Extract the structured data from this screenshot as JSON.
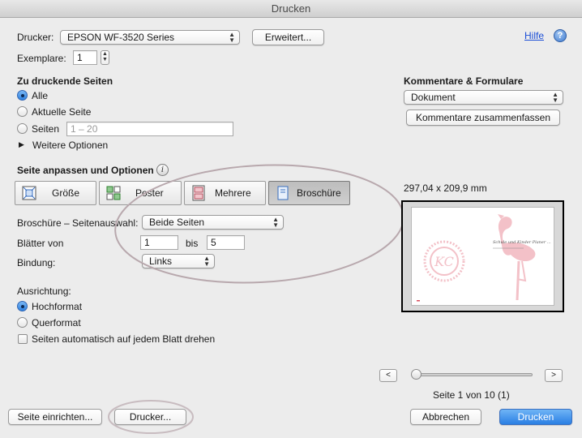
{
  "window": {
    "title": "Drucken"
  },
  "printer": {
    "label": "Drucker:",
    "selected": "EPSON WF-3520 Series",
    "advanced_button": "Erweitert..."
  },
  "help": {
    "label": "Hilfe",
    "icon": "?"
  },
  "copies": {
    "label": "Exemplare:",
    "value": "1"
  },
  "pages": {
    "heading": "Zu druckende Seiten",
    "options": [
      {
        "label": "Alle",
        "selected": true
      },
      {
        "label": "Aktuelle Seite",
        "selected": false
      },
      {
        "label": "Seiten",
        "selected": false
      }
    ],
    "range_placeholder": "1 – 20",
    "more_options": "Weitere Optionen"
  },
  "comments": {
    "heading": "Kommentare & Formulare",
    "selected": "Dokument",
    "summarize_button": "Kommentare zusammenfassen"
  },
  "fit": {
    "heading": "Seite anpassen und Optionen",
    "tiles": [
      {
        "label": "Größe",
        "icon": "size-icon"
      },
      {
        "label": "Poster",
        "icon": "poster-icon"
      },
      {
        "label": "Mehrere",
        "icon": "multiple-icon"
      },
      {
        "label": "Broschüre",
        "icon": "booklet-icon",
        "selected": true
      }
    ]
  },
  "booklet": {
    "subset_label": "Broschüre – Seitenauswahl:",
    "subset_value": "Beide Seiten",
    "sheets_label": "Blätter von",
    "sheets_from": "1",
    "sheets_to_label": "bis",
    "sheets_to": "5",
    "binding_label": "Bindung:",
    "binding_value": "Links"
  },
  "orientation": {
    "heading": "Ausrichtung:",
    "options": [
      {
        "label": "Hochformat",
        "selected": true
      },
      {
        "label": "Querformat",
        "selected": false
      }
    ],
    "auto_rotate": "Seiten automatisch auf jedem Blatt drehen"
  },
  "preview": {
    "size": "297,04 x 209,9 mm",
    "page_info": "Seite 1 von 10 (1)",
    "prev": "<",
    "next": ">",
    "logo_text": "KC",
    "script_text": "Schule und Kinder Planer ..."
  },
  "footer": {
    "page_setup": "Seite einrichten...",
    "printer": "Drucker...",
    "cancel": "Abbrechen",
    "print": "Drucken"
  },
  "colors": {
    "accent": "#2a7fe3",
    "preview_pink": "#f3c1c8",
    "annotation_circle": "#b8a8ad"
  }
}
